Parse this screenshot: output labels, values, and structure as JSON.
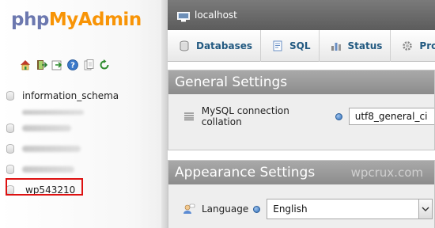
{
  "logo": {
    "php": "php",
    "my": "My",
    "admin": "Admin"
  },
  "sidebar": {
    "toolbar_icons": [
      "home-icon",
      "exit-icon",
      "query-window-icon",
      "documentation-icon",
      "docs-icon",
      "reload-icon"
    ],
    "databases": [
      {
        "label": "information_schema",
        "obscured": false
      },
      {
        "label": "",
        "obscured": true
      },
      {
        "label": "",
        "obscured": true
      },
      {
        "label": "",
        "obscured": true
      },
      {
        "label": "_wp543210",
        "obscured": false
      }
    ],
    "highlight_color": "#dd1111"
  },
  "header": {
    "server": "localhost"
  },
  "tabs": [
    {
      "label": "Databases",
      "icon": "database-icon"
    },
    {
      "label": "SQL",
      "icon": "sql-icon"
    },
    {
      "label": "Status",
      "icon": "status-icon"
    },
    {
      "label": "Pro",
      "icon": "processes-icon"
    }
  ],
  "general_settings": {
    "title": "General Settings",
    "collation_label": "MySQL connection collation",
    "collation_value": "utf8_general_ci"
  },
  "appearance_settings": {
    "title": "Appearance Settings",
    "watermark": "wpcrux.com",
    "language_label": "Language",
    "language_value": "English"
  },
  "colors": {
    "tab_text": "#235a81",
    "logo_php": "#6c78af",
    "logo_admin": "#f89406"
  }
}
